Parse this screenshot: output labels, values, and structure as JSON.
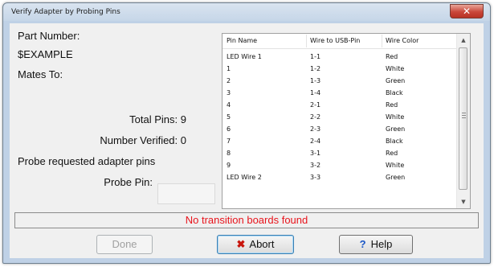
{
  "window": {
    "title": "Verify Adapter by Probing Pins",
    "close_glyph": "✕"
  },
  "left": {
    "part_number_label": "Part Number:",
    "part_number_value": "$EXAMPLE",
    "mates_to_label": "Mates To:",
    "total_pins": "Total Pins: 9",
    "number_verified": "Number Verified: 0",
    "probe_requested": "Probe requested adapter pins",
    "probe_pin_label": "Probe Pin:",
    "probe_pin_value": ""
  },
  "table": {
    "columns": [
      "Pin Name",
      "Wire to USB-Pin",
      "Wire Color"
    ],
    "rows": [
      [
        "LED Wire 1",
        "1-1",
        "Red"
      ],
      [
        "1",
        "1-2",
        "White"
      ],
      [
        "2",
        "1-3",
        "Green"
      ],
      [
        "3",
        "1-4",
        "Black"
      ],
      [
        "4",
        "2-1",
        "Red"
      ],
      [
        "5",
        "2-2",
        "White"
      ],
      [
        "6",
        "2-3",
        "Green"
      ],
      [
        "7",
        "2-4",
        "Black"
      ],
      [
        "8",
        "3-1",
        "Red"
      ],
      [
        "9",
        "3-2",
        "White"
      ],
      [
        "LED Wire 2",
        "3-3",
        "Green"
      ]
    ],
    "scroll_up_glyph": "▲",
    "scroll_down_glyph": "▼"
  },
  "status": {
    "message": "No transition boards found",
    "color": "#e8141c"
  },
  "buttons": {
    "done": "Done",
    "abort_icon": "✖",
    "abort": "Abort",
    "help_icon": "?",
    "help": "Help"
  }
}
